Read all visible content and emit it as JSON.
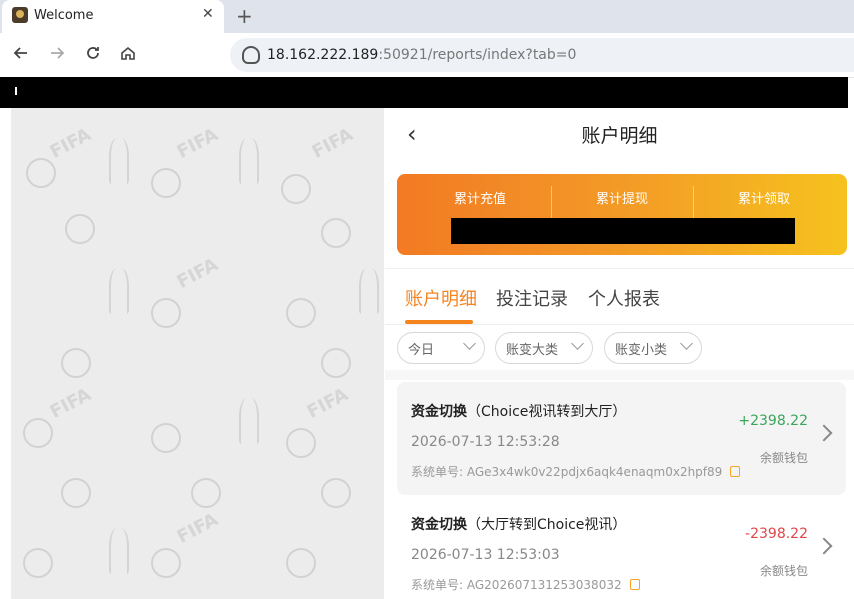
{
  "browser": {
    "tab_title": "Welcome",
    "close_glyph": "✕",
    "newtab_glyph": "+",
    "url_host": "18.162.222.189",
    "url_rest": ":50921/reports/index?tab=0"
  },
  "header": {
    "title": "账户明细",
    "back_glyph": "‹"
  },
  "summary": {
    "labels": [
      "累计充值",
      "累计提现",
      "累计领取"
    ]
  },
  "tabs": [
    {
      "label": "账户明细",
      "active": true
    },
    {
      "label": "投注记录",
      "active": false
    },
    {
      "label": "个人报表",
      "active": false
    }
  ],
  "filters": [
    "今日",
    "账变大类",
    "账变小类"
  ],
  "records": [
    {
      "type": "资金切换",
      "desc": "（Choice视讯转到大厅）",
      "time": "2026-07-13 12:53:28",
      "order_label": "系统单号:",
      "order_no": "AGe3x4wk0v22pdjx6aqk4enaqm0x2hpf89",
      "amount": "+2398.22",
      "wallet": "余额钱包"
    },
    {
      "type": "资金切换",
      "desc": "（大厅转到Choice视讯）",
      "time": "2026-07-13 12:53:03",
      "order_label": "系统单号:",
      "order_no": "AG202607131253038032",
      "amount": "-2398.22",
      "wallet": "余额钱包"
    }
  ],
  "colors": {
    "accent": "#f5841f",
    "positive": "#3aa55a",
    "negative": "#e0454a"
  }
}
